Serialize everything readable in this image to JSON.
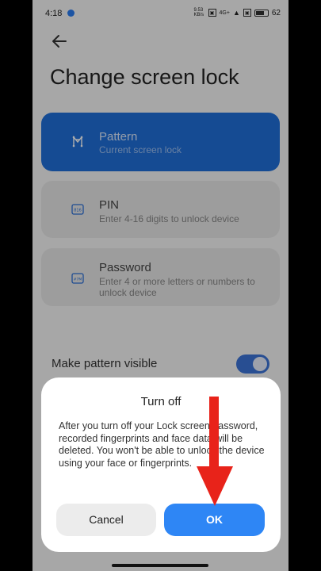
{
  "status": {
    "time": "4:18",
    "net_speed": "9.53 KB/s",
    "network": "4G+",
    "battery": "62"
  },
  "page": {
    "title": "Change screen lock"
  },
  "options": [
    {
      "title": "Pattern",
      "subtitle": "Current screen lock",
      "icon": "pattern-icon"
    },
    {
      "title": "PIN",
      "subtitle": "Enter 4-16 digits to unlock device",
      "icon": "pin-icon",
      "icon_text": "816"
    },
    {
      "title": "Password",
      "subtitle": "Enter 4 or more letters or numbers to unlock device",
      "icon": "password-icon",
      "icon_text": "#7M"
    }
  ],
  "setting": {
    "label": "Make pattern visible",
    "enabled": true
  },
  "dialog": {
    "title": "Turn off",
    "body": "After you turn off your Lock screen password, recorded fingerprints and face data will be deleted. You won't be able to unlock the device using your face or fingerprints.",
    "cancel_label": "Cancel",
    "ok_label": "OK"
  },
  "colors": {
    "accent": "#1f6fd9",
    "ok_button": "#2e86f5",
    "annotation_arrow": "#e8231a"
  }
}
